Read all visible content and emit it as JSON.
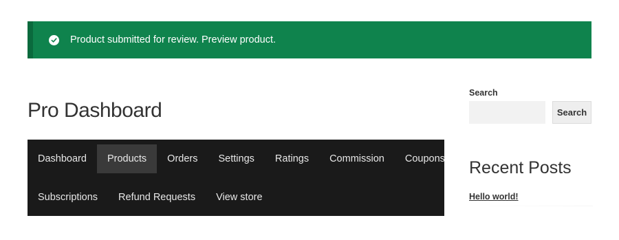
{
  "notice": {
    "message": "Product submitted for review.",
    "link_label": "Preview product.",
    "icon": "check-circle-icon",
    "color": "#0f834d"
  },
  "page": {
    "title": "Pro Dashboard"
  },
  "nav": {
    "row1": [
      "Dashboard",
      "Products",
      "Orders",
      "Settings",
      "Ratings",
      "Commission",
      "Coupons"
    ],
    "row2": [
      "Subscriptions",
      "Refund Requests",
      "View store"
    ],
    "active": "Products",
    "background": "#1a1a1a"
  },
  "sidebar": {
    "search_label": "Search",
    "search_value": "",
    "search_button": "Search",
    "recent_posts_title": "Recent Posts",
    "posts": [
      "Hello world!"
    ]
  }
}
